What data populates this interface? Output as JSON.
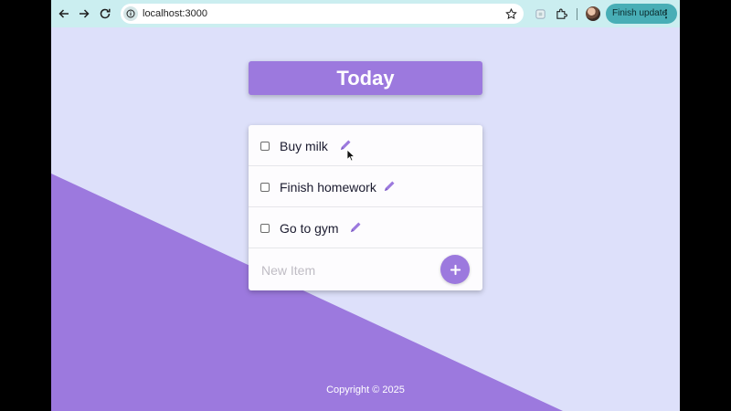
{
  "browser": {
    "url": "localhost:3000",
    "update_button_label": "Finish update",
    "menu_glyph": "⋮",
    "colors": {
      "toolbar": "#cbeef0",
      "update_button": "#48aeb6"
    }
  },
  "app": {
    "title": "Today",
    "items": [
      {
        "label": "Buy milk",
        "checked": false
      },
      {
        "label": "Finish homework",
        "checked": false
      },
      {
        "label": "Go to gym",
        "checked": false
      }
    ],
    "new_item_placeholder": "New Item",
    "add_button_glyph": "+",
    "footer": "Copyright © 2025",
    "colors": {
      "accent": "#9c79de",
      "background": "#dde0fa",
      "card": "#fdfcfe"
    }
  }
}
